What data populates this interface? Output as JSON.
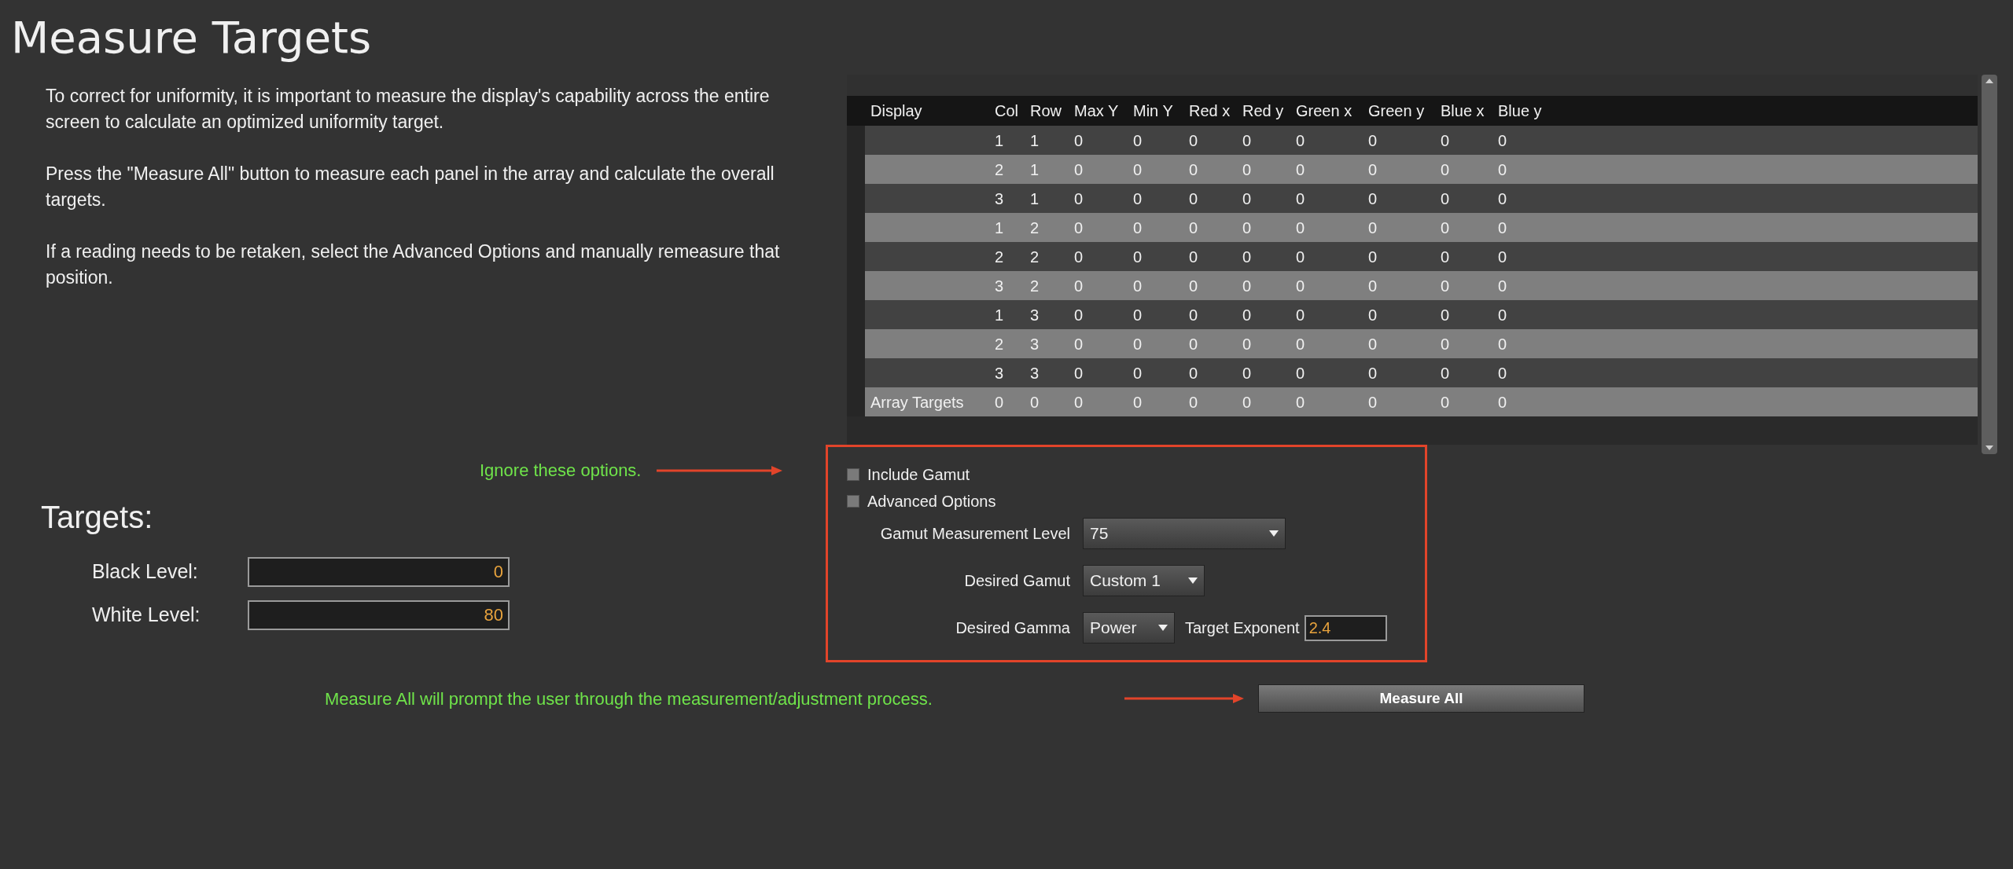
{
  "title": "Measure Targets",
  "intro": [
    "To correct for uniformity, it is important to measure the display's capability across the entire screen to calculate an optimized uniformity target.",
    "Press the \"Measure All\" button to measure each panel in the array and calculate the overall targets.",
    "If a reading needs to be retaken, select the Advanced Options and manually remeasure that position."
  ],
  "table": {
    "columns": [
      "Display",
      "Col",
      "Row",
      "Max Y",
      "Min Y",
      "Red x",
      "Red y",
      "Green x",
      "Green y",
      "Blue x",
      "Blue y"
    ],
    "rows": [
      {
        "values": [
          "1",
          "1",
          "0",
          "0",
          "0",
          "0",
          "0",
          "0",
          "0",
          "0"
        ]
      },
      {
        "values": [
          "2",
          "1",
          "0",
          "0",
          "0",
          "0",
          "0",
          "0",
          "0",
          "0"
        ]
      },
      {
        "values": [
          "3",
          "1",
          "0",
          "0",
          "0",
          "0",
          "0",
          "0",
          "0",
          "0"
        ]
      },
      {
        "values": [
          "1",
          "2",
          "0",
          "0",
          "0",
          "0",
          "0",
          "0",
          "0",
          "0"
        ]
      },
      {
        "values": [
          "2",
          "2",
          "0",
          "0",
          "0",
          "0",
          "0",
          "0",
          "0",
          "0"
        ]
      },
      {
        "values": [
          "3",
          "2",
          "0",
          "0",
          "0",
          "0",
          "0",
          "0",
          "0",
          "0"
        ]
      },
      {
        "values": [
          "1",
          "3",
          "0",
          "0",
          "0",
          "0",
          "0",
          "0",
          "0",
          "0"
        ]
      },
      {
        "values": [
          "2",
          "3",
          "0",
          "0",
          "0",
          "0",
          "0",
          "0",
          "0",
          "0"
        ]
      },
      {
        "values": [
          "3",
          "3",
          "0",
          "0",
          "0",
          "0",
          "0",
          "0",
          "0",
          "0"
        ]
      },
      {
        "display": "Array Targets",
        "values": [
          "0",
          "0",
          "0",
          "0",
          "0",
          "0",
          "0",
          "0",
          "0",
          "0"
        ]
      }
    ]
  },
  "options_note": "Ignore these options.",
  "options": {
    "checkboxes": [
      {
        "label": "Include Gamut",
        "checked": false
      },
      {
        "label": "Advanced Options",
        "checked": false
      }
    ],
    "gamut_level": {
      "label": "Gamut Measurement Level",
      "value": "75"
    },
    "desired_gamut": {
      "label": "Desired Gamut",
      "value": "Custom 1"
    },
    "desired_gamma": {
      "label": "Desired Gamma",
      "value": "Power"
    },
    "target_exponent": {
      "label": "Target Exponent",
      "value": "2.4"
    }
  },
  "targets": {
    "heading": "Targets:",
    "fields": [
      {
        "label": "Black Level:",
        "value": "0"
      },
      {
        "label": "White Level:",
        "value": "80"
      }
    ]
  },
  "measure_note": "Measure All will prompt the user through the measurement/adjustment process.",
  "measure_button": "Measure All"
}
